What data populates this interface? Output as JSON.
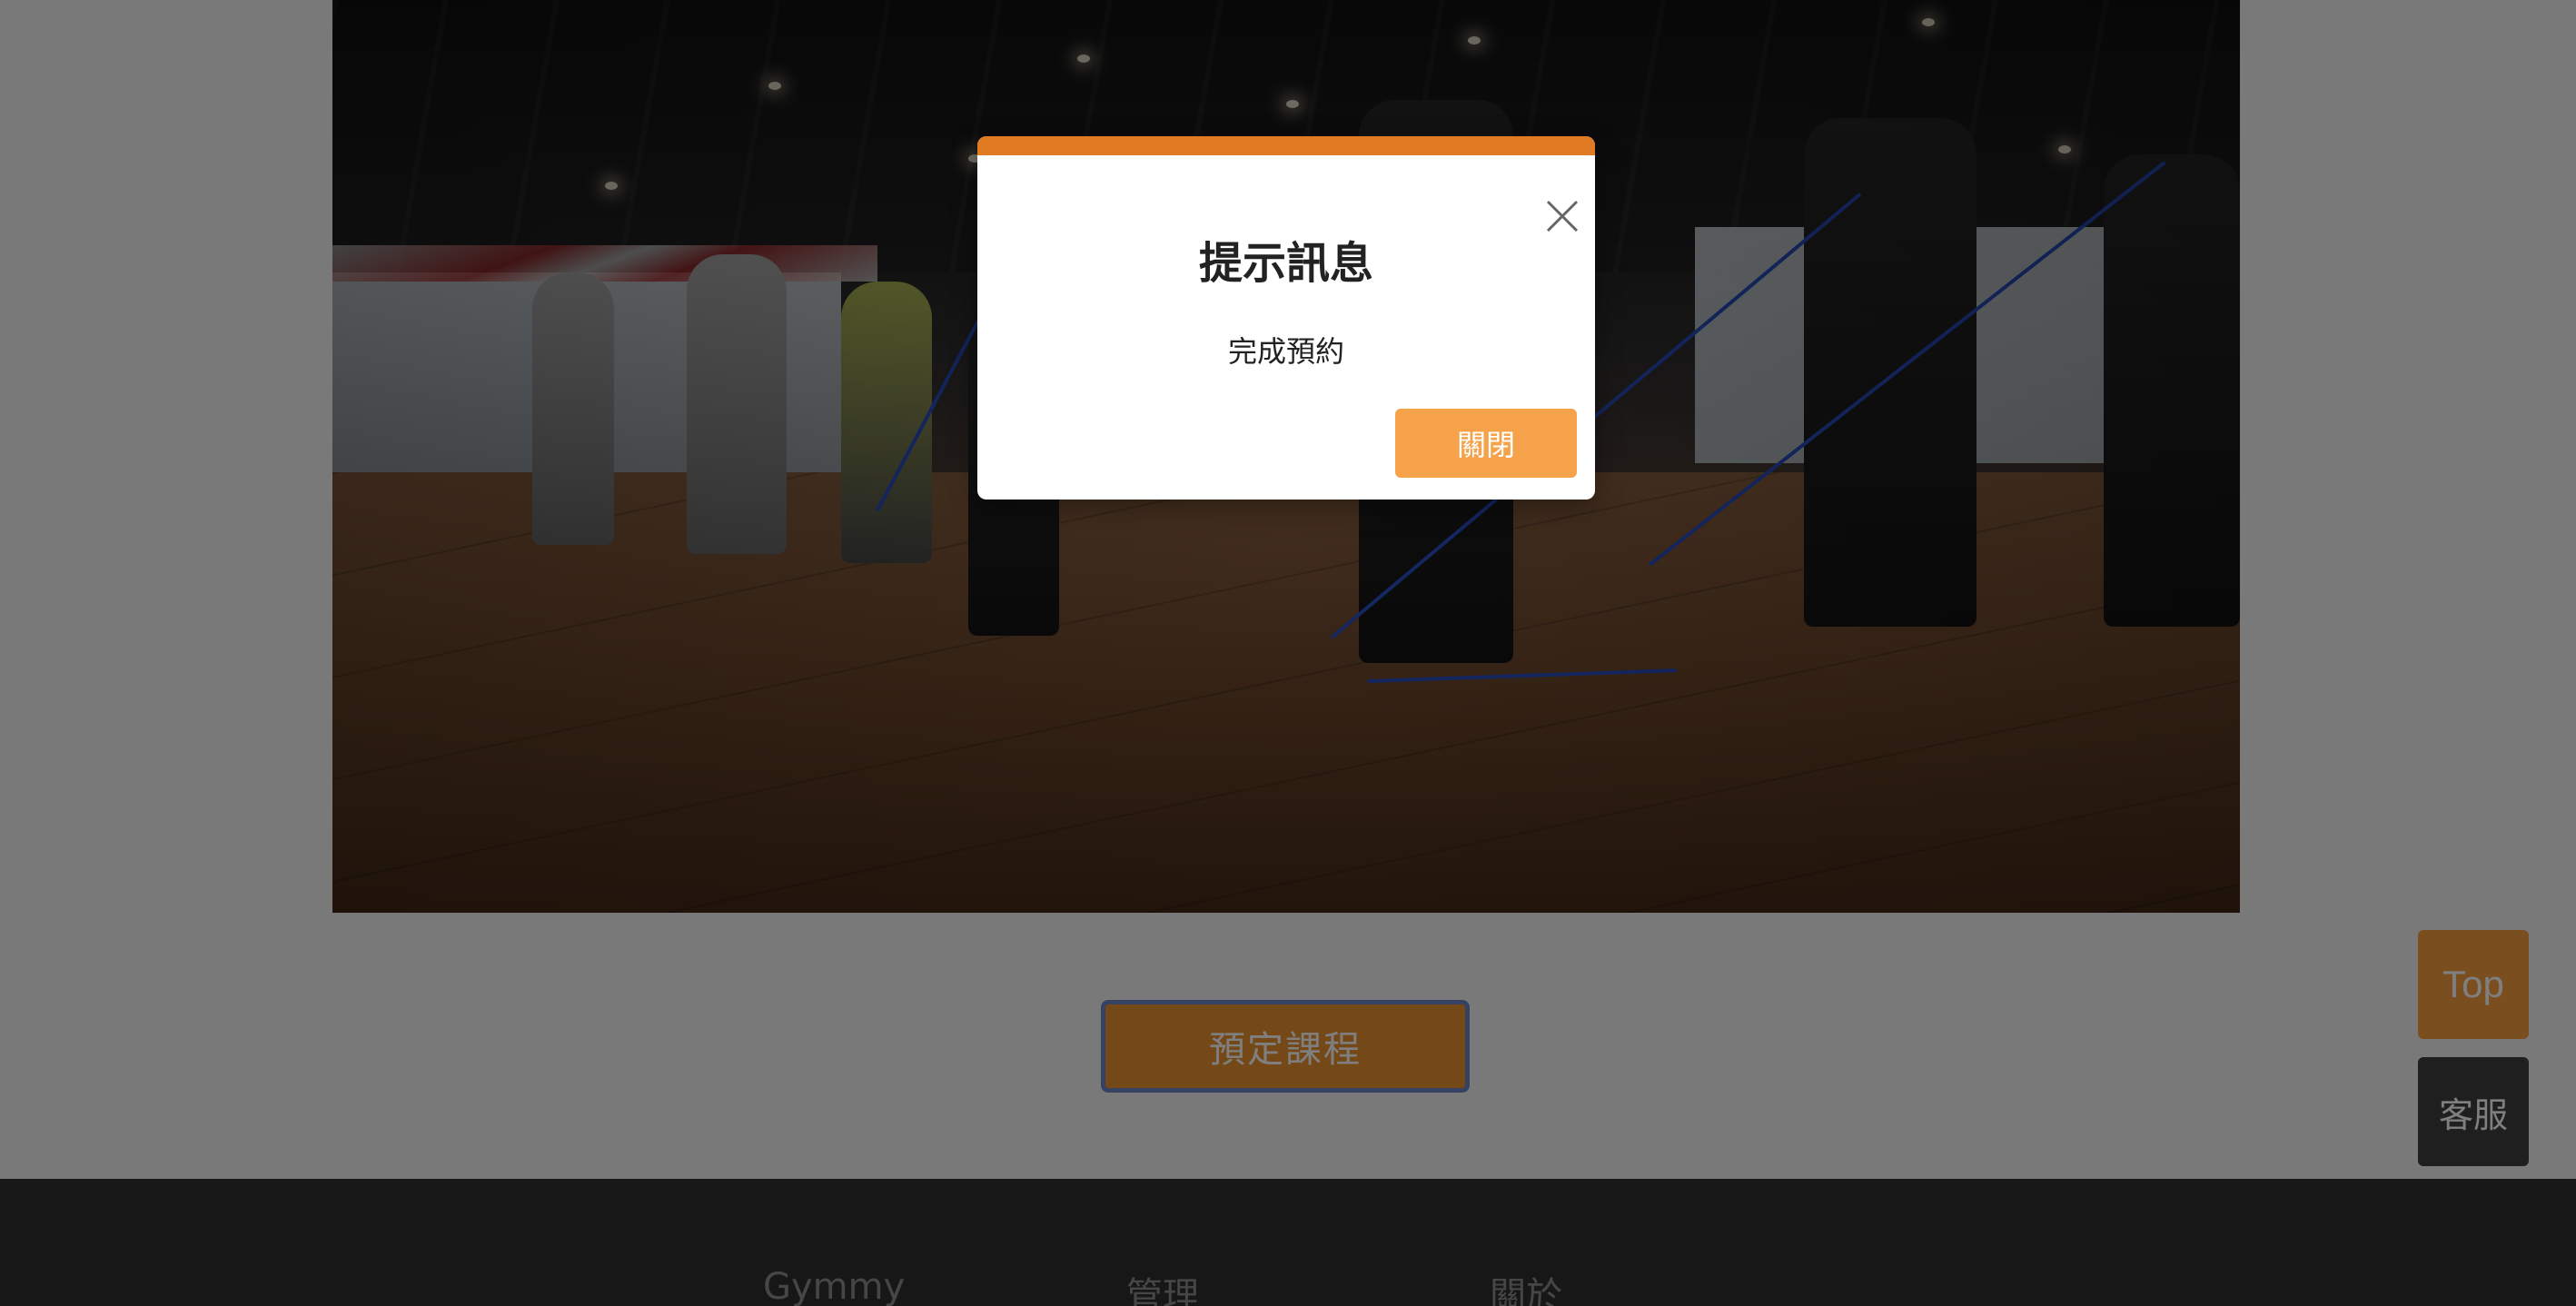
{
  "hero": {
    "image_alt": "group fitness class with resistance bands"
  },
  "booking": {
    "button_label": "預定課程"
  },
  "floating": {
    "top_label": "Top",
    "service_label": "客服"
  },
  "footer": {
    "columns": [
      "Gymmy",
      "管理",
      "關於"
    ]
  },
  "modal": {
    "title": "提示訊息",
    "message": "完成預約",
    "close_button_label": "關閉",
    "close_icon": "close-icon"
  },
  "colors": {
    "accent": "#e07b24",
    "button": "#f5a24a",
    "footer_bg": "#2f2f2f"
  }
}
